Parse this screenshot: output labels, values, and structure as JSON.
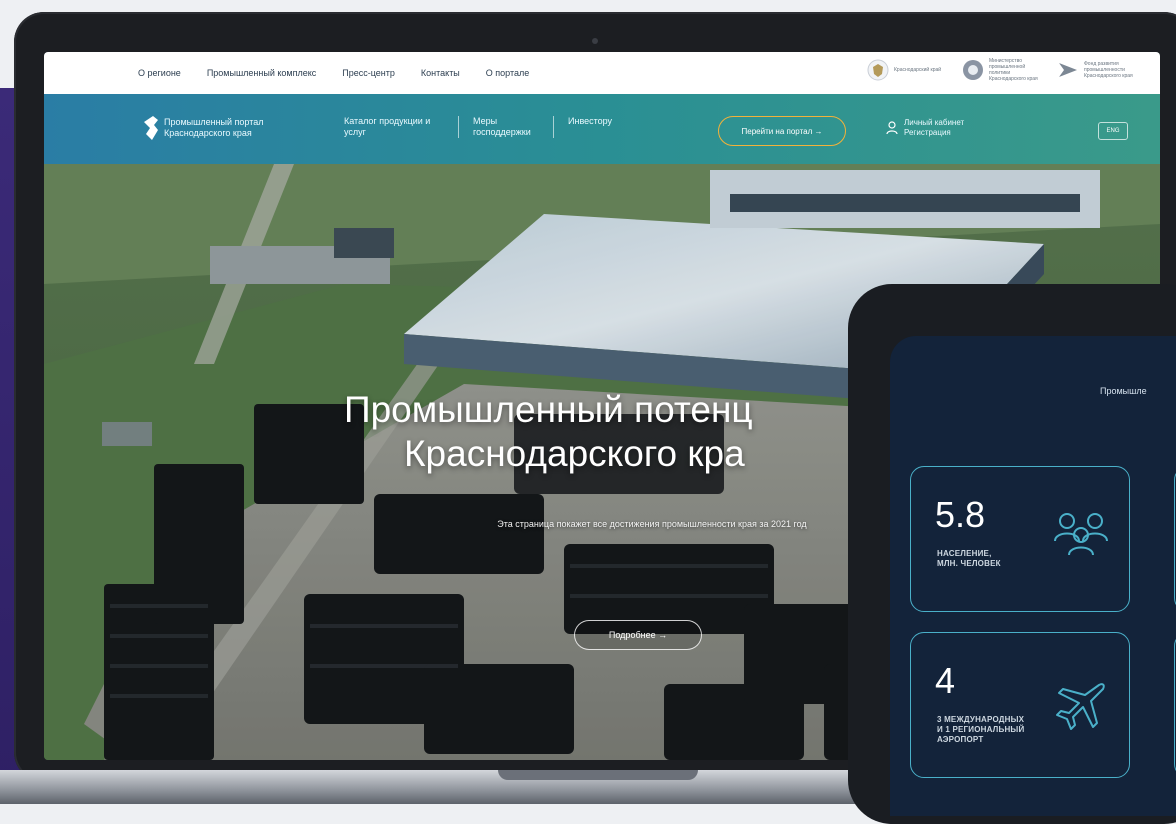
{
  "top_nav": {
    "links": [
      "О регионе",
      "Промышленный комплекс",
      "Пресс-центр",
      "Контакты",
      "О портале"
    ],
    "partners": [
      {
        "name": "Краснодарский край"
      },
      {
        "name": "Министерство промышленной политики Краснодарского края"
      },
      {
        "name": "Фонд развития промышленности Краснодарского края"
      }
    ]
  },
  "main_nav": {
    "brand": "Промышленный портал Краснодарского края",
    "menu": [
      "Каталог продукции и услуг",
      "Меры господдержки",
      "Инвестору"
    ],
    "portal_button": "Перейти на портал →",
    "cabinet": [
      "Личный кабинет",
      "Регистрация"
    ],
    "lang": "ENG"
  },
  "hero": {
    "title_line1": "Промышленный потенц",
    "title_line2": "Краснодарского кра",
    "subtitle": "Эта страница покажет все достижения промышленности края за 2021 год",
    "more_button": "Подробнее →"
  },
  "tablet": {
    "title": "Промышле",
    "stats": [
      {
        "value": "5.8",
        "label_line1": "НАСЕЛЕНИЕ,",
        "label_line2": "МЛН. ЧЕЛОВЕК",
        "icon": "people-icon"
      },
      {
        "value": "4",
        "label_line1": "3 МЕЖДУНАРОДНЫХ",
        "label_line2": "И 1 РЕГИОНАЛЬНЫЙ",
        "label_line3": "АЭРОПОРТ",
        "icon": "airplane-icon"
      }
    ]
  },
  "colors": {
    "nav_teal": "#2a8f94",
    "accent_orange": "#f2b23a",
    "tablet_bg": "#13233a",
    "stat_border": "#4ab0c9",
    "side_purple": "#3b2a78"
  }
}
